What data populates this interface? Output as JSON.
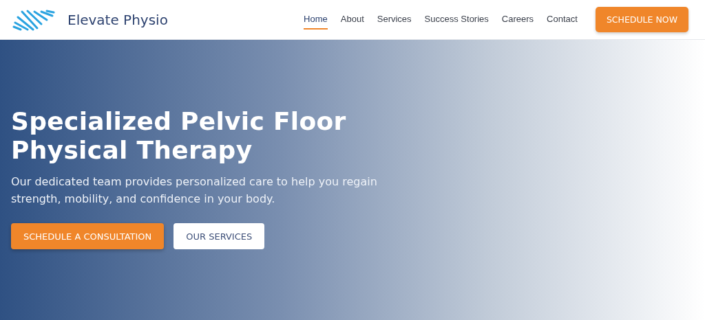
{
  "brand": {
    "name": "Elevate Physio"
  },
  "nav": [
    {
      "label": "Home",
      "selected": true
    },
    {
      "label": "About",
      "selected": false
    },
    {
      "label": "Services",
      "selected": false
    },
    {
      "label": "Success Stories",
      "selected": false
    },
    {
      "label": "Careers",
      "selected": false
    },
    {
      "label": "Contact",
      "selected": false
    }
  ],
  "header_button": "SCHEDULE NOW",
  "hero": {
    "title": "Specialized Pelvic Floor Physical Therapy",
    "subtitle": "Our dedicated team provides personalized care to help you regain strength, mobility, and confidence in your body.",
    "buttons": [
      {
        "label": "SCHEDULE A CONSULTATION",
        "kind": "primary"
      },
      {
        "label": "OUR SERVICES",
        "kind": "secondary"
      }
    ]
  }
}
